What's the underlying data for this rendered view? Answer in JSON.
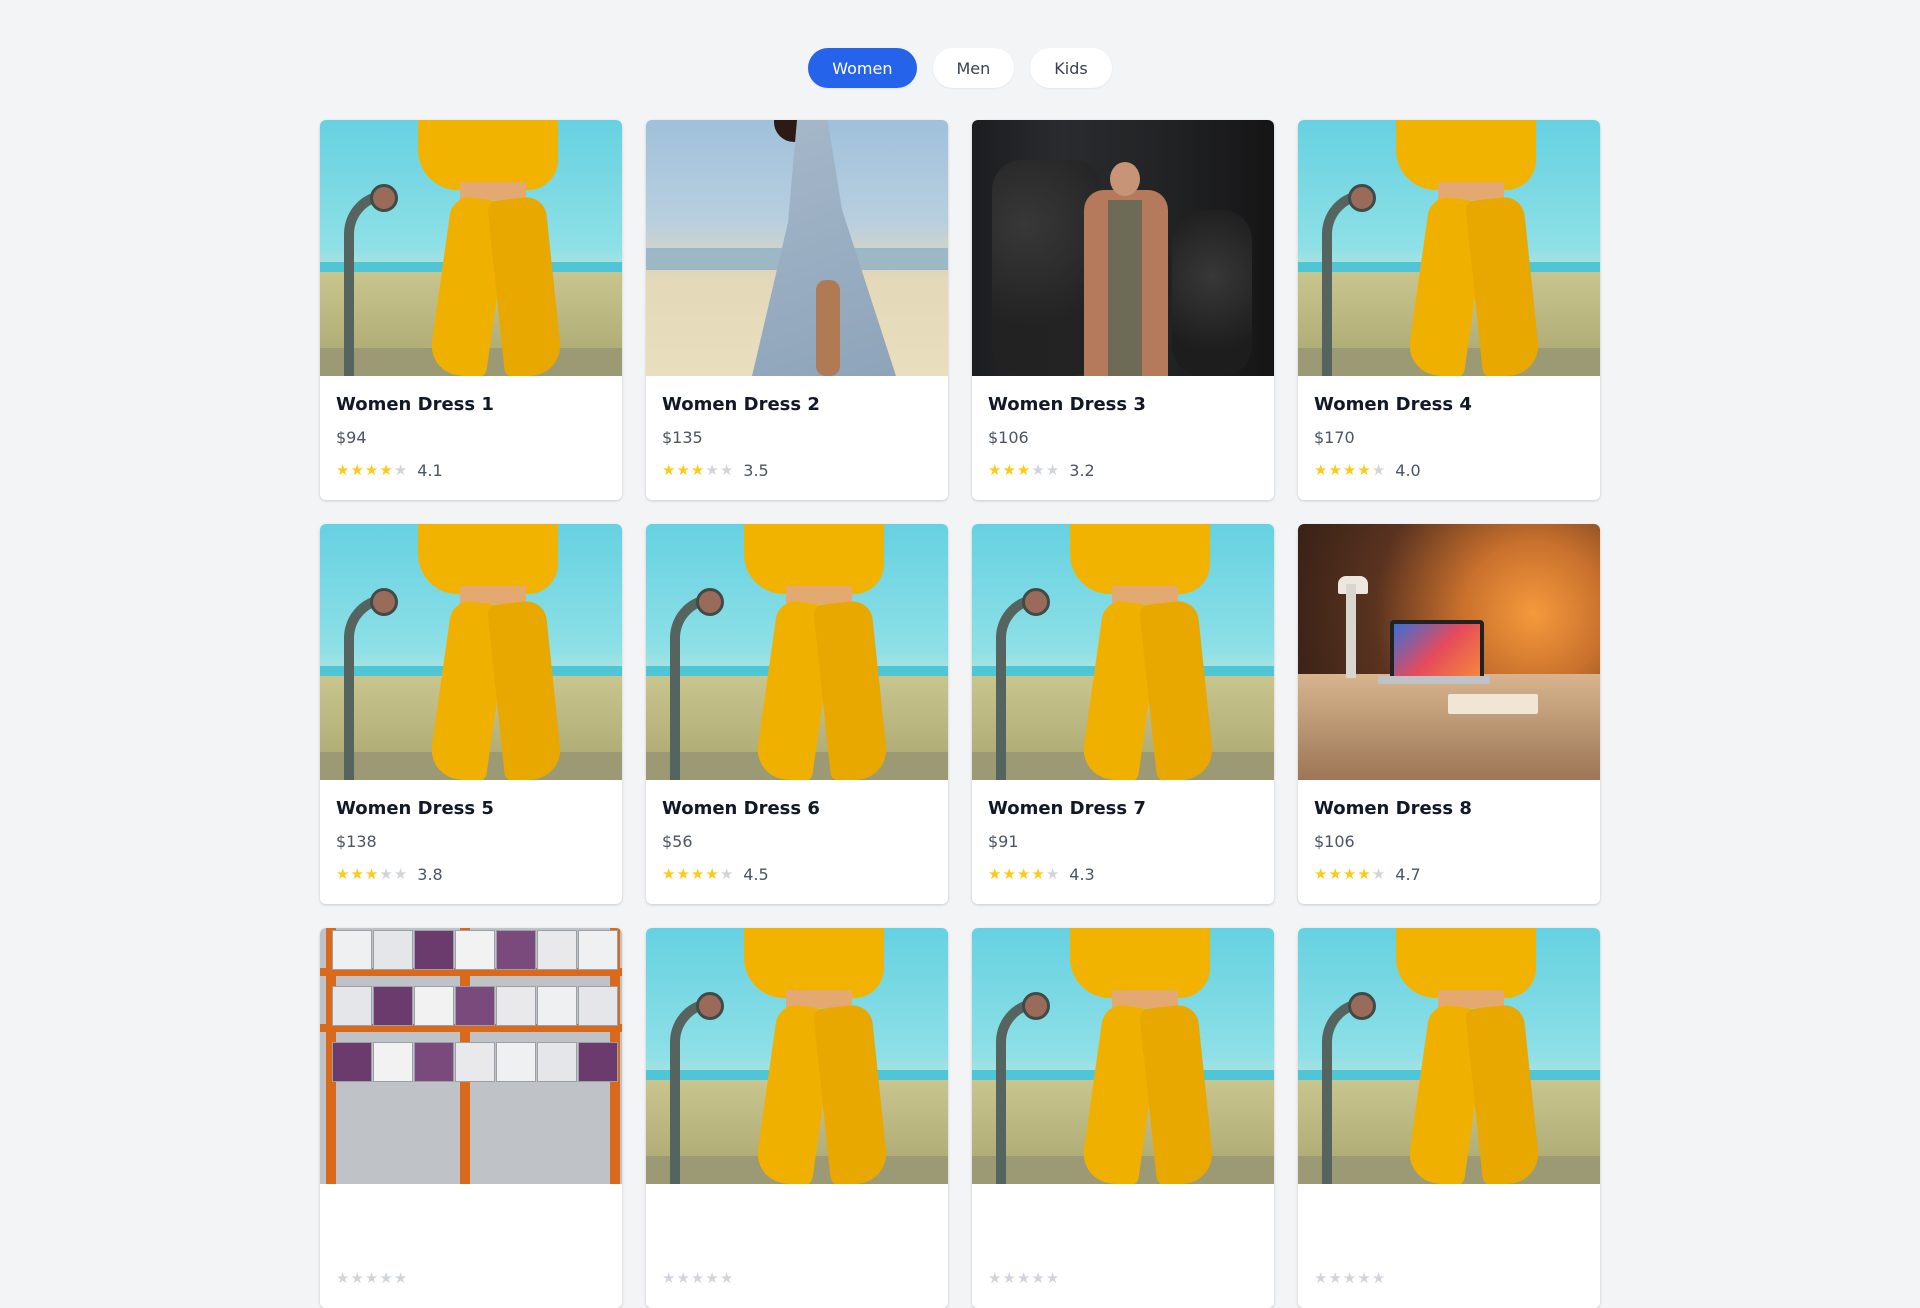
{
  "tabs": [
    {
      "label": "Women",
      "active": true
    },
    {
      "label": "Men",
      "active": false
    },
    {
      "label": "Kids",
      "active": false
    }
  ],
  "products": [
    {
      "name": "Women Dress 1",
      "price": "$94",
      "rating": "4.1",
      "stars": 4,
      "image": "yellow-tracksuit-photo"
    },
    {
      "name": "Women Dress 2",
      "price": "$135",
      "rating": "3.5",
      "stars": 3,
      "image": "blue-dress-beach-photo"
    },
    {
      "name": "Women Dress 3",
      "price": "$106",
      "rating": "3.2",
      "stars": 3,
      "image": "coat-ivy-wall-photo"
    },
    {
      "name": "Women Dress 4",
      "price": "$170",
      "rating": "4.0",
      "stars": 4,
      "image": "yellow-tracksuit-photo"
    },
    {
      "name": "Women Dress 5",
      "price": "$138",
      "rating": "3.8",
      "stars": 3,
      "image": "yellow-tracksuit-photo"
    },
    {
      "name": "Women Dress 6",
      "price": "$56",
      "rating": "4.5",
      "stars": 4,
      "image": "yellow-tracksuit-photo"
    },
    {
      "name": "Women Dress 7",
      "price": "$91",
      "rating": "4.3",
      "stars": 4,
      "image": "yellow-tracksuit-photo"
    },
    {
      "name": "Women Dress 8",
      "price": "$106",
      "rating": "4.7",
      "stars": 4,
      "image": "desk-laptop-photo"
    },
    {
      "name": "",
      "price": "",
      "rating": "",
      "stars": 0,
      "image": "warehouse-shelves-photo"
    },
    {
      "name": "",
      "price": "",
      "rating": "",
      "stars": 0,
      "image": "yellow-tracksuit-photo"
    },
    {
      "name": "",
      "price": "",
      "rating": "",
      "stars": 0,
      "image": "yellow-tracksuit-photo"
    },
    {
      "name": "",
      "price": "",
      "rating": "",
      "stars": 0,
      "image": "yellow-tracksuit-photo"
    }
  ],
  "colors": {
    "accent": "#2563eb",
    "star_filled": "#facc15",
    "star_empty": "#d1d5db",
    "background": "#f3f4f6"
  }
}
